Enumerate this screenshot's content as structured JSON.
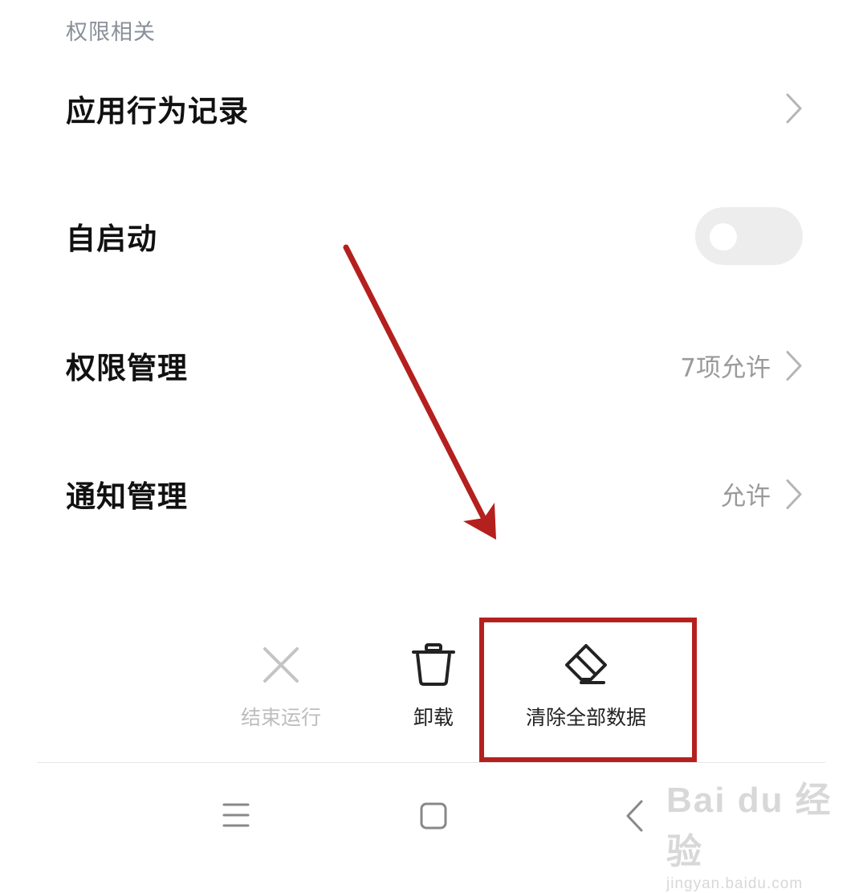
{
  "section": {
    "title": "权限相关"
  },
  "rows": [
    {
      "label": "应用行为记录",
      "value": ""
    },
    {
      "label": "自启动",
      "toggle_on": false
    },
    {
      "label": "权限管理",
      "value": "7项允许"
    },
    {
      "label": "通知管理",
      "value": "允许"
    }
  ],
  "actions": [
    {
      "label": "结束运行",
      "icon": "close-icon",
      "enabled": false
    },
    {
      "label": "卸载",
      "icon": "trash-icon",
      "enabled": true
    },
    {
      "label": "清除全部数据",
      "icon": "eraser-icon",
      "enabled": true
    }
  ],
  "nav": {
    "icons": [
      "menu-icon",
      "home-square-icon",
      "back-chevron-icon"
    ]
  },
  "annotation": {
    "color": "#b4201e"
  },
  "watermark": {
    "brand": "Bai du 经验",
    "url": "jingyan.baidu.com"
  }
}
